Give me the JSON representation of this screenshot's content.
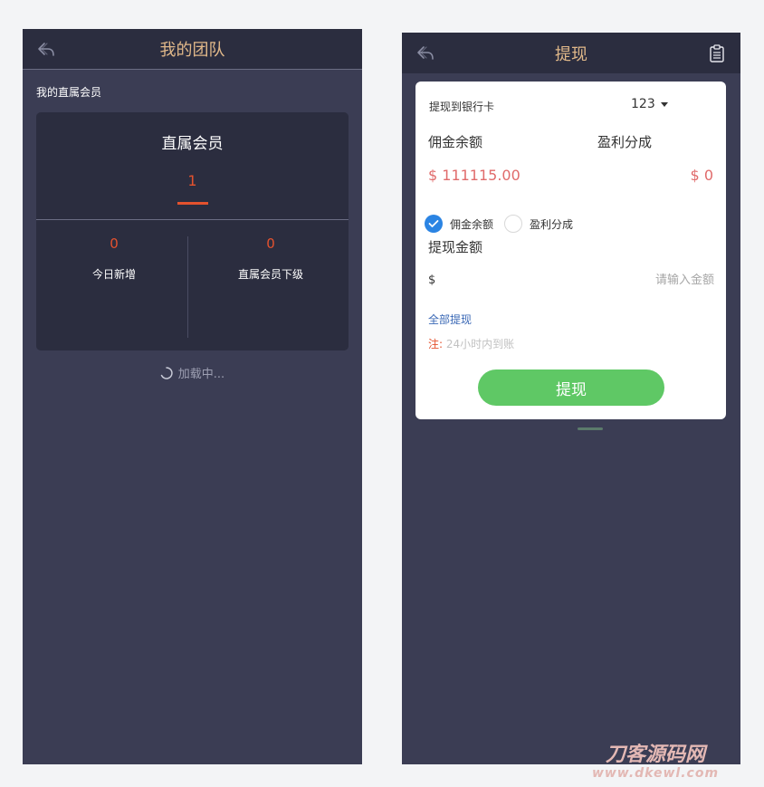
{
  "team_screen": {
    "header": {
      "title": "我的团队"
    },
    "section_label": "我的直属会员",
    "card": {
      "title": "直属会员",
      "count": "1",
      "stats": [
        {
          "value": "0",
          "label": "今日新增"
        },
        {
          "value": "0",
          "label": "直属会员下级"
        }
      ]
    },
    "loading_text": "加载中..."
  },
  "withdraw_screen": {
    "header": {
      "title": "提现"
    },
    "bank": {
      "label": "提现到银行卡",
      "selected": "123"
    },
    "balances": [
      {
        "label": "佣金余额",
        "value": "$ 111115.00"
      },
      {
        "label": "盈利分成",
        "value": "$ 0"
      }
    ],
    "radio_options": [
      {
        "label": "佣金余额",
        "checked": true
      },
      {
        "label": "盈利分成",
        "checked": false
      }
    ],
    "amount": {
      "title": "提现金额",
      "currency": "$",
      "value": "",
      "placeholder": "请输入金额"
    },
    "withdraw_all_label": "全部提现",
    "note": {
      "prefix": "注:",
      "text": "24小时内到账"
    },
    "submit_label": "提现"
  },
  "watermark": {
    "text": "刀客源码网",
    "sub": "www.dkewl.com"
  },
  "colors": {
    "header_bg": "#2b2d3f",
    "page_bg": "#3b3d54",
    "accent_orange": "#e4522e",
    "title_gold": "#e0b889",
    "balance_red": "#e06b6b",
    "button_green": "#5fc865",
    "radio_blue": "#2b84e3"
  }
}
